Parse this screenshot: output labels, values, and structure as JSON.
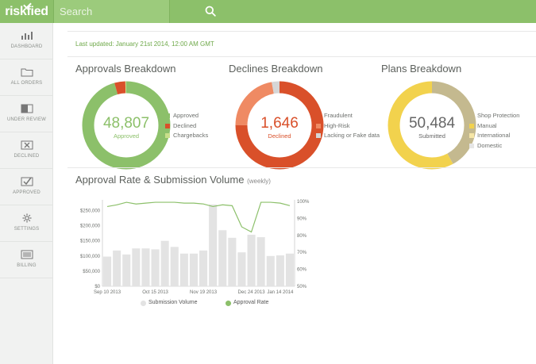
{
  "app": {
    "logo_text": "risk",
    "logo_text2": "fied"
  },
  "search": {
    "placeholder": "Search"
  },
  "sidebar": {
    "items": [
      {
        "label": "DASHBOARD",
        "icon": "bar-chart-icon"
      },
      {
        "label": "ALL ORDERS",
        "icon": "folder-icon"
      },
      {
        "label": "UNDER REVIEW",
        "icon": "review-icon"
      },
      {
        "label": "DECLINED",
        "icon": "declined-icon"
      },
      {
        "label": "APPROVED",
        "icon": "approved-icon"
      },
      {
        "label": "SETTINGS",
        "icon": "gear-icon"
      },
      {
        "label": "BILLING",
        "icon": "billing-icon"
      }
    ]
  },
  "main": {
    "last_updated": "Last updated: January 21st 2014, 12:00 AM GMT",
    "approvals": {
      "title": "Approvals Breakdown",
      "value": "48,807",
      "sub": "Approved",
      "legend": [
        "Approved",
        "Declined",
        "Chargebacks"
      ],
      "colors": [
        "#8cc06a",
        "#d9502a",
        "#c9df8a"
      ],
      "shares": [
        0.955,
        0.04,
        0.005
      ]
    },
    "declines": {
      "title": "Declines Breakdown",
      "value": "1,646",
      "sub": "Declined",
      "legend": [
        "Fraudulent",
        "High-Risk",
        "Lacking or Fake data"
      ],
      "colors": [
        "#d9502a",
        "#ef8a63",
        "#d6d6d6"
      ],
      "shares": [
        0.75,
        0.22,
        0.03
      ]
    },
    "plans": {
      "title": "Plans Breakdown",
      "value": "50,484",
      "sub": "Submitted",
      "legend": [
        "Shop Protection",
        "Manual",
        "International",
        "Domestic"
      ],
      "colors": [
        "#c4b98f",
        "#f2d24d",
        "#f6e6a6",
        "#e6e6e6"
      ],
      "shares": [
        0.42,
        0.58,
        0.0,
        0.0
      ]
    },
    "chart_title": "Approval Rate & Submission Volume",
    "chart_title_note": "(weekly)"
  },
  "chart_data": {
    "type": "bar",
    "categories": [
      "Sep 10 2013",
      "",
      "",
      "",
      "",
      "Oct 15 2013",
      "",
      "",
      "",
      "",
      "Nov 19 2013",
      "",
      "",
      "",
      "",
      "Dec 24 2013",
      "",
      "",
      "Jan 14 2014",
      ""
    ],
    "series": [
      {
        "name": "Submission Volume",
        "type": "bar",
        "axis": "left",
        "color": "#e3e3e3",
        "values": [
          98000,
          118000,
          105000,
          125000,
          125000,
          122000,
          150000,
          130000,
          108000,
          108000,
          118000,
          270000,
          185000,
          160000,
          112000,
          170000,
          162000,
          100000,
          102000,
          108000
        ]
      },
      {
        "name": "Approval Rate",
        "type": "line",
        "axis": "right",
        "color": "#8cc06a",
        "values": [
          97.0,
          98.0,
          99.5,
          98.5,
          99.0,
          99.5,
          99.5,
          99.5,
          99.0,
          99.0,
          98.5,
          97.0,
          98.0,
          97.5,
          85.0,
          82.0,
          99.5,
          99.5,
          99.0,
          97.5
        ]
      }
    ],
    "y_left": {
      "ticks": [
        "$0",
        "$50,000",
        "$100,000",
        "$150,000",
        "$200,000",
        "$250,000"
      ],
      "range": [
        0,
        280000
      ]
    },
    "y_right": {
      "ticks": [
        "50%",
        "60%",
        "70%",
        "80%",
        "90%",
        "100%"
      ],
      "range": [
        50,
        100
      ]
    },
    "x_ticks": [
      "Sep 10 2013",
      "Oct 15 2013",
      "Nov 19 2013",
      "Dec 24 2013",
      "Jan 14 2014"
    ],
    "legend": [
      "Submission Volume",
      "Approval Rate"
    ],
    "grid": false,
    "legend_position": "bottom"
  }
}
